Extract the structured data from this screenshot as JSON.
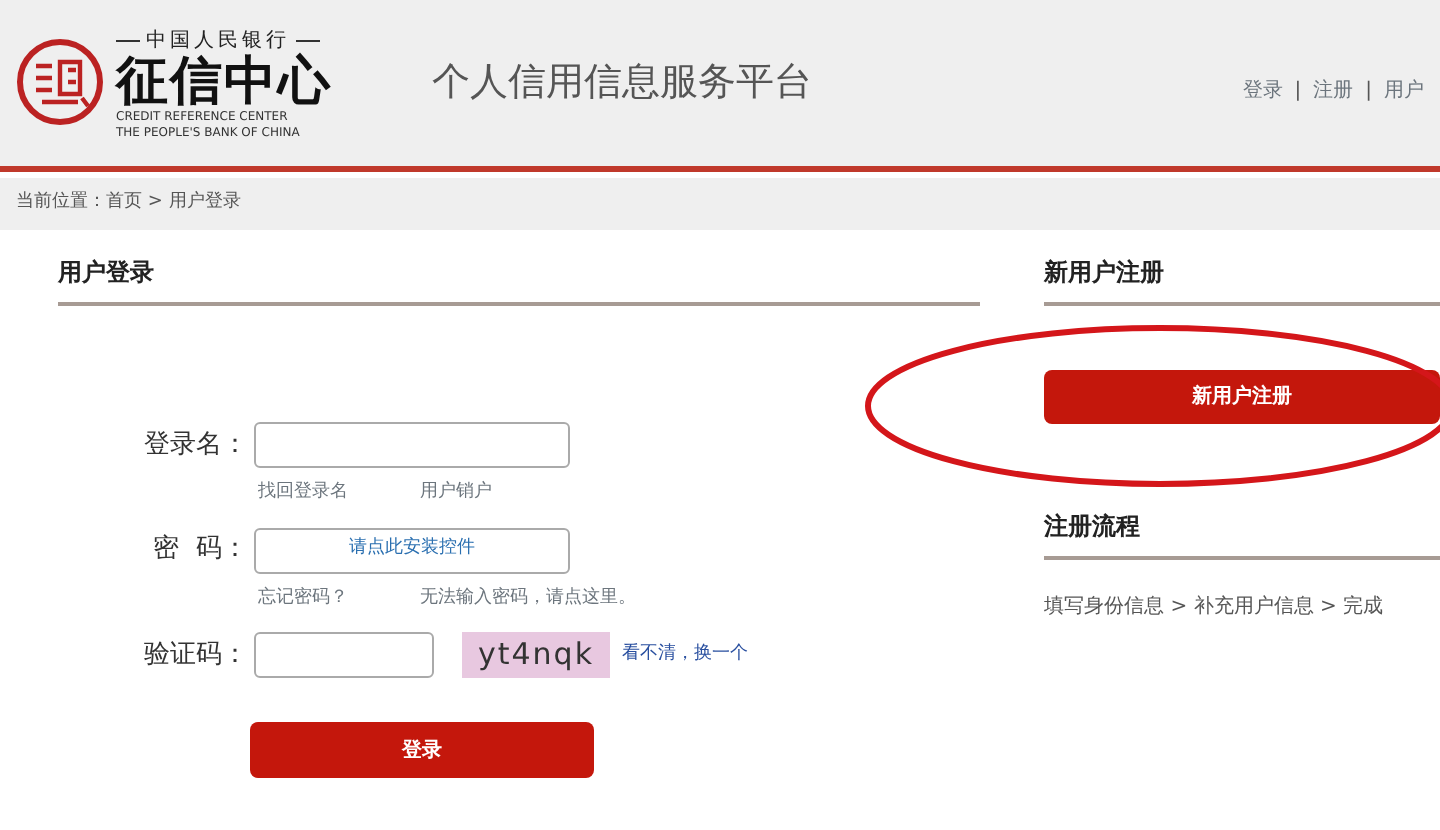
{
  "header": {
    "logo": {
      "org_name": "中国人民银行",
      "title": "征信中心",
      "english_lines": [
        "CREDIT REFERENCE CENTER",
        "THE PEOPLE'S BANK OF CHINA"
      ]
    },
    "platform_title": "个人信用信息服务平台",
    "top_links": [
      {
        "label": "登录"
      },
      {
        "label": "注册"
      },
      {
        "label": "用户"
      }
    ],
    "separator": "|"
  },
  "breadcrumb": "当前位置：首页 > 用户登录",
  "login": {
    "title": "用户登录",
    "fields": [
      {
        "kind": "text",
        "label": "登录名：",
        "links": [
          "找回登录名",
          "用户销户"
        ]
      },
      {
        "kind": "prompt",
        "label": "密  码：",
        "prompt": "请点此安装控件",
        "links": [
          "忘记密码？",
          "无法输入密码，请点这里。"
        ]
      },
      {
        "kind": "captcha",
        "label": "验证码：",
        "captcha": "yt4nqk",
        "refresh": "看不清，换一个"
      }
    ],
    "button": "登录"
  },
  "register": {
    "title": "新用户注册",
    "button": "新用户注册",
    "flow_title": "注册流程",
    "flow": "填写身份信息 > 补充用户信息 > 完成"
  },
  "annotation": {
    "kind": "ellipse"
  }
}
